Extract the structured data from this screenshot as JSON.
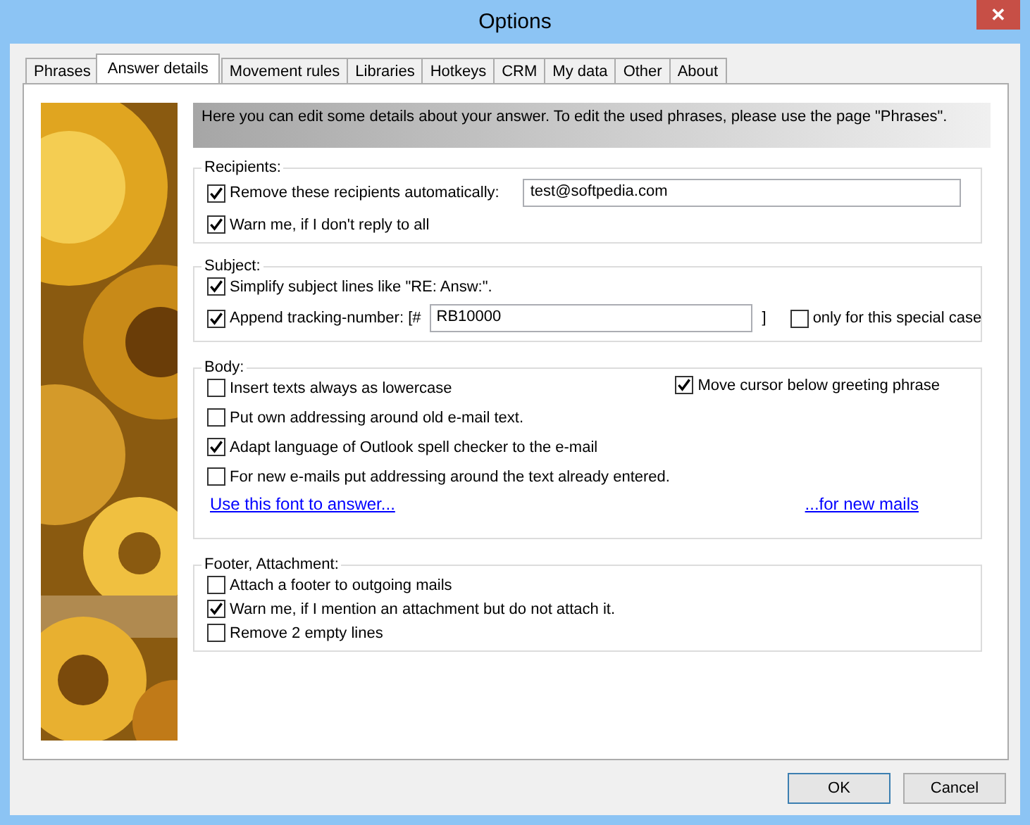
{
  "window": {
    "title": "Options",
    "close": "✕"
  },
  "tabs": [
    {
      "label": "Phrases",
      "selected": false
    },
    {
      "label": "Answer details",
      "selected": true
    },
    {
      "label": "Movement rules",
      "selected": false
    },
    {
      "label": "Libraries",
      "selected": false
    },
    {
      "label": "Hotkeys",
      "selected": false
    },
    {
      "label": "CRM",
      "selected": false
    },
    {
      "label": "My data",
      "selected": false
    },
    {
      "label": "Other",
      "selected": false
    },
    {
      "label": "About",
      "selected": false
    }
  ],
  "info": "Here you can edit some details about your answer. To edit the used phrases, please use the page \"Phrases\".",
  "recipients": {
    "label": "Recipients:",
    "options": [
      {
        "kind": "field",
        "label": "Remove these recipients automatically:",
        "checked": true,
        "value": "test@softpedia.com"
      },
      {
        "kind": "checkbox",
        "label": "Warn me, if I don't reply to all",
        "checked": true
      }
    ]
  },
  "subject": {
    "label": "Subject:",
    "options": [
      {
        "kind": "checkbox",
        "label": "Simplify subject lines like \"RE: Answ:\".",
        "checked": true
      },
      {
        "kind": "tracking",
        "label": "Append tracking-number: [#",
        "checked": true,
        "value": "RB10000",
        "closing": "]",
        "extra": {
          "label": "only for this special case",
          "checked": false
        }
      }
    ]
  },
  "body": {
    "label": "Body:",
    "side_option": {
      "label": "Move cursor below greeting phrase",
      "checked": true
    },
    "options": [
      {
        "kind": "checkbox",
        "label": "Insert texts always as lowercase",
        "checked": false
      },
      {
        "kind": "checkbox",
        "label": "Put own addressing around old e-mail text.",
        "checked": false
      },
      {
        "kind": "checkbox",
        "label": "Adapt language of Outlook spell checker to the e-mail",
        "checked": true
      },
      {
        "kind": "checkbox",
        "label": "For new e-mails put addressing around the text already entered.",
        "checked": false
      }
    ],
    "links": [
      "Use this font to answer...",
      "...for new mails"
    ]
  },
  "footer": {
    "label": "Footer, Attachment:",
    "options": [
      {
        "kind": "checkbox",
        "label": "Attach a footer to outgoing mails",
        "checked": false
      },
      {
        "kind": "checkbox",
        "label": "Warn me, if I mention an attachment but do not attach it.",
        "checked": true
      },
      {
        "kind": "checkbox",
        "label": "Remove 2 empty lines",
        "checked": false
      }
    ]
  },
  "buttons": [
    {
      "label": "OK",
      "default": true
    },
    {
      "label": "Cancel",
      "default": false
    }
  ]
}
